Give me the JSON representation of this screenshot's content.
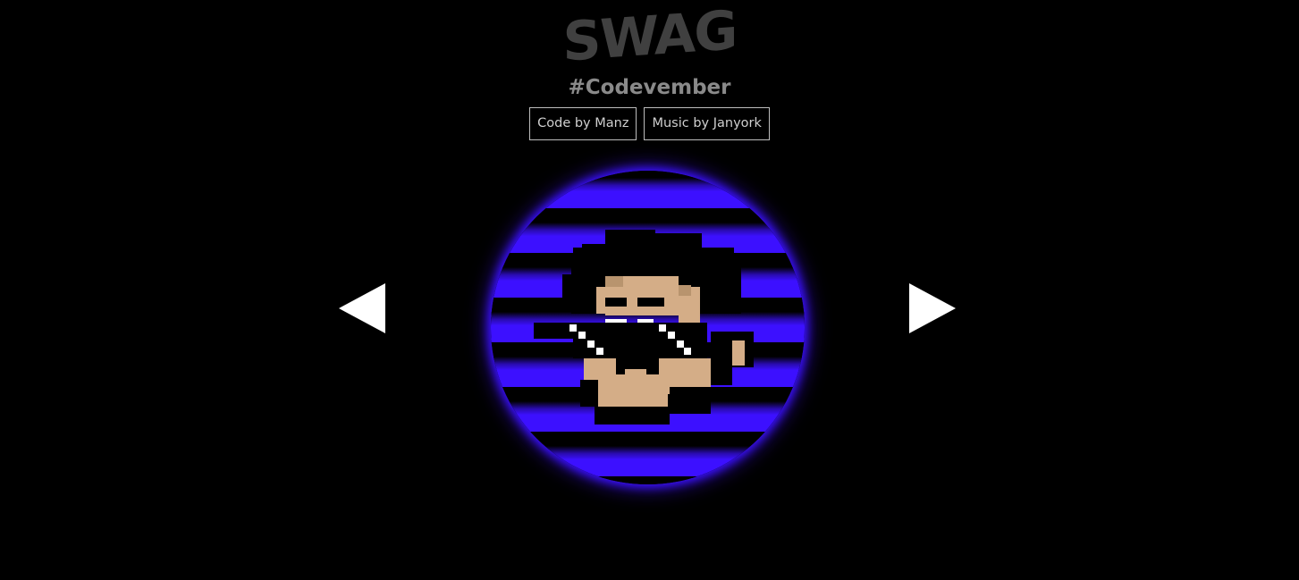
{
  "header": {
    "title": "SWAG",
    "subtitle": "#Codevember"
  },
  "credits": {
    "code_label": "Code by Manz",
    "music_label": "Music by Janyork"
  },
  "player": {
    "prev_icon": "triangle-left-icon",
    "next_icon": "triangle-right-icon",
    "accent_color": "#3c10ff"
  }
}
